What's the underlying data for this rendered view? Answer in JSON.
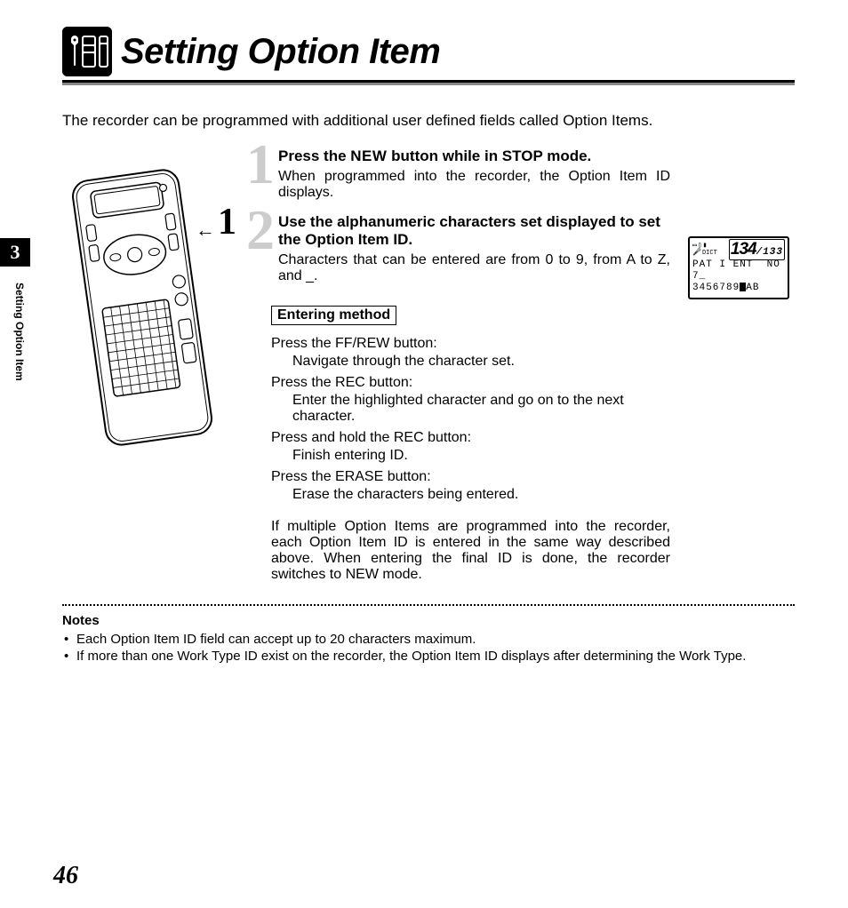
{
  "section_number": "3",
  "vertical_label": "Setting Option Item",
  "title": "Setting Option Item",
  "intro": "The recorder can be programmed with additional user defined fields called Option Items.",
  "device_callout": "1",
  "device_arrow": "←",
  "steps": {
    "s1": {
      "num": "1",
      "head_pre": "Press the ",
      "head_new": "NEW",
      "head_post": " button while in STOP mode.",
      "body": "When programmed into the recorder, the Option Item ID displays."
    },
    "s2": {
      "num": "2",
      "head": "Use the alphanumeric characters set displayed to set the Option Item ID.",
      "body": "Characters that can be entered are from 0 to 9, from A to Z, and _."
    }
  },
  "entering_label": "Entering method",
  "method": {
    "m1": {
      "press": "Press the FF/REW button:",
      "desc": "Navigate through the character set."
    },
    "m2": {
      "press": "Press the REC button:",
      "desc": "Enter the highlighted character and go on to the next character."
    },
    "m3": {
      "press": "Press and hold the REC button:",
      "desc": "Finish entering ID."
    },
    "m4": {
      "press": "Press the ERASE button:",
      "desc": "Erase the characters being entered."
    }
  },
  "final_para": "If multiple Option Items are programmed into the recorder, each Option Item ID is entered in the same way described above. When entering the final ID is done, the recorder switches to NEW mode.",
  "lcd": {
    "seg_main": "134",
    "seg_sub": "/133",
    "dict_label": "DICT",
    "line1": "PAT I ENT  NO",
    "line2": "7_",
    "line3_pre": "3456789",
    "line3_post": "AB"
  },
  "notes_head": "Notes",
  "notes": {
    "n1": "Each Option Item ID field can accept up to 20 characters maximum.",
    "n2": "If more than one Work Type ID exist on the recorder, the Option Item ID displays after determining the Work Type."
  },
  "page_number": "46"
}
